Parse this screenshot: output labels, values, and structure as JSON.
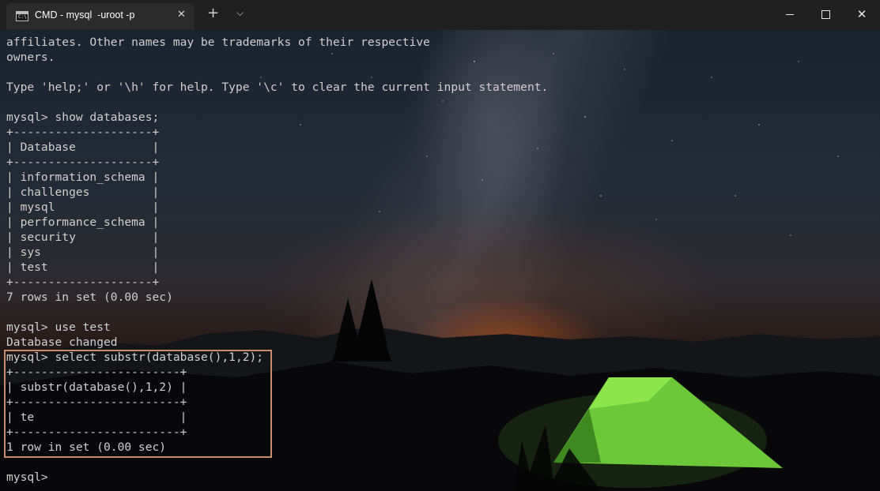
{
  "window": {
    "tab_title": "CMD - mysql  -uroot -p",
    "tab_icon_label": "C:\\",
    "tab_close_glyph": "✕",
    "new_tab_glyph": "+",
    "dropdown_glyph": "⌵",
    "close_glyph": "✕",
    "icons": [
      "cmd-icon",
      "close-icon",
      "plus-icon",
      "chevron-down-icon",
      "minimize-icon",
      "maximize-icon",
      "window-close-icon"
    ]
  },
  "terminal": {
    "lines": [
      "affiliates. Other names may be trademarks of their respective",
      "owners.",
      "",
      "Type 'help;' or '\\h' for help. Type '\\c' to clear the current input statement.",
      "",
      "mysql> show databases;",
      "+--------------------+",
      "| Database           |",
      "+--------------------+",
      "| information_schema |",
      "| challenges         |",
      "| mysql              |",
      "| performance_schema |",
      "| security           |",
      "| sys                |",
      "| test               |",
      "+--------------------+",
      "7 rows in set (0.00 sec)",
      "",
      "mysql> use test",
      "Database changed",
      "mysql> select substr(database(),1,2);",
      "+------------------------+",
      "| substr(database(),1,2) |",
      "+------------------------+",
      "| te                     |",
      "+------------------------+",
      "1 row in set (0.00 sec)",
      "",
      "mysql>"
    ]
  },
  "colors": {
    "text": "#cfcfcf",
    "titlebar": "#202020",
    "tab": "#2b2b2b",
    "highlight": "#c98b69",
    "tent": "#7ee03a"
  }
}
